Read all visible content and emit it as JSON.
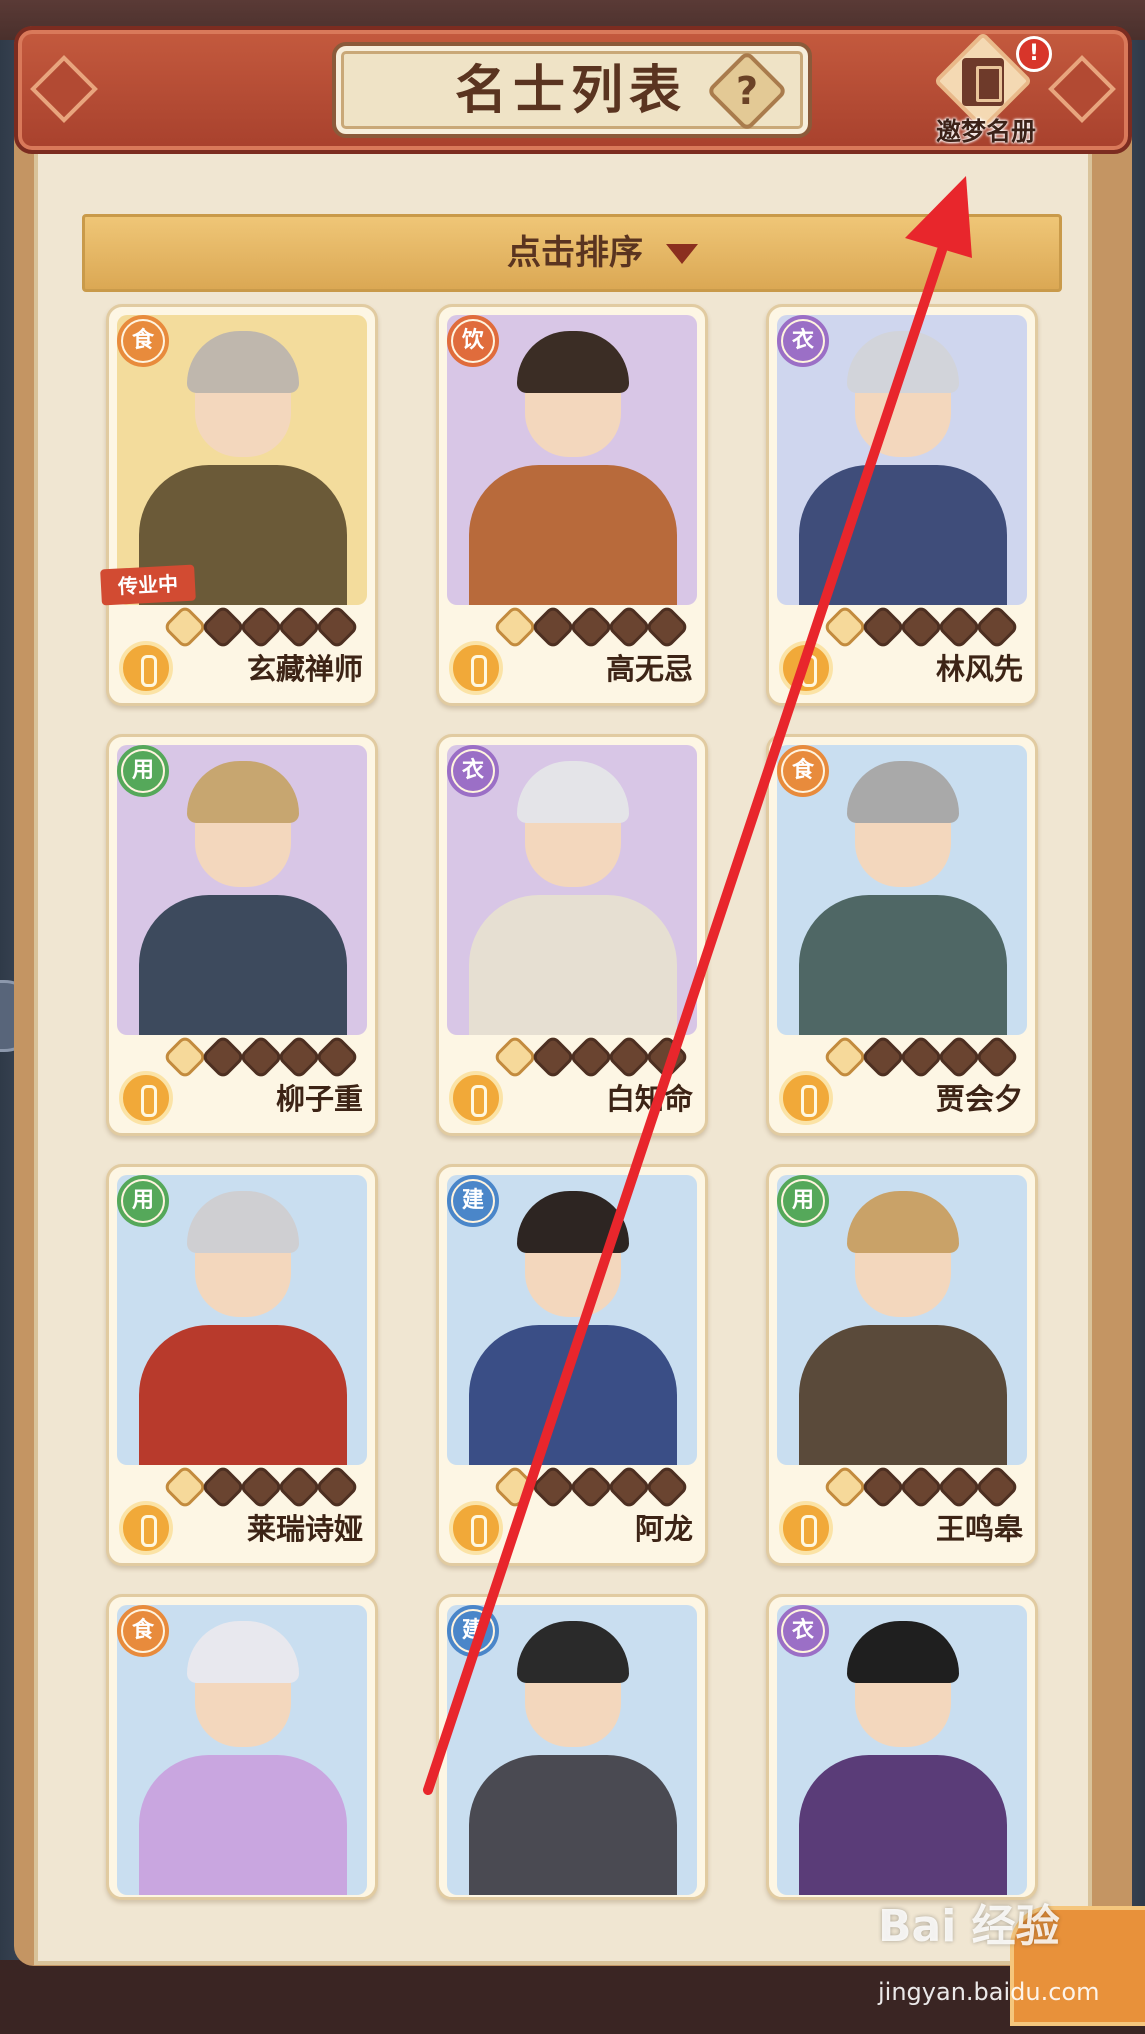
{
  "header": {
    "title": "名士列表",
    "help_symbol": "?",
    "book_label": "邀梦名册",
    "alert_symbol": "!"
  },
  "sort": {
    "label": "点击排序"
  },
  "cards": [
    {
      "name": "玄藏禅师",
      "type": "食",
      "type_color": "#e88b3c",
      "bg": "#f3dc9c",
      "hair": "#bfb7ad",
      "robe": "#6b5a38",
      "stars_filled": 1,
      "stars_total": 5,
      "tag": "传业中"
    },
    {
      "name": "高无忌",
      "type": "饮",
      "type_color": "#e06c3c",
      "bg": "#d8c6e6",
      "hair": "#3b2d25",
      "robe": "#b86a3b",
      "stars_filled": 1,
      "stars_total": 5,
      "tag": ""
    },
    {
      "name": "林风先",
      "type": "衣",
      "type_color": "#9b6fc6",
      "bg": "#cfd6ee",
      "hair": "#d2d4da",
      "robe": "#3f4d7a",
      "stars_filled": 1,
      "stars_total": 5,
      "tag": ""
    },
    {
      "name": "柳子重",
      "type": "用",
      "type_color": "#55a85a",
      "bg": "#d8c6e6",
      "hair": "#c7a670",
      "robe": "#3d4a5d",
      "stars_filled": 1,
      "stars_total": 5,
      "tag": ""
    },
    {
      "name": "白知命",
      "type": "衣",
      "type_color": "#9b6fc6",
      "bg": "#d8c6e6",
      "hair": "#e4e4e8",
      "robe": "#e6dfd2",
      "stars_filled": 1,
      "stars_total": 5,
      "tag": ""
    },
    {
      "name": "贾会夕",
      "type": "食",
      "type_color": "#e88b3c",
      "bg": "#c9def0",
      "hair": "#a9a9a9",
      "robe": "#4f6765",
      "stars_filled": 1,
      "stars_total": 5,
      "tag": ""
    },
    {
      "name": "莱瑞诗娅",
      "type": "用",
      "type_color": "#55a85a",
      "bg": "#c9def0",
      "hair": "#cfcfd2",
      "robe": "#b83a2c",
      "stars_filled": 1,
      "stars_total": 5,
      "tag": ""
    },
    {
      "name": "阿龙",
      "type": "建",
      "type_color": "#4a86c9",
      "bg": "#c9def0",
      "hair": "#2d2522",
      "robe": "#3a4e86",
      "stars_filled": 1,
      "stars_total": 5,
      "tag": ""
    },
    {
      "name": "王鸣皋",
      "type": "用",
      "type_color": "#55a85a",
      "bg": "#c9def0",
      "hair": "#c9a268",
      "robe": "#5a4a3a",
      "stars_filled": 1,
      "stars_total": 5,
      "tag": ""
    },
    {
      "name": "",
      "type": "食",
      "type_color": "#e88b3c",
      "bg": "#c9def0",
      "hair": "#e8e8ee",
      "robe": "#c9a6e0",
      "stars_filled": 1,
      "stars_total": 5,
      "tag": ""
    },
    {
      "name": "",
      "type": "建",
      "type_color": "#4a86c9",
      "bg": "#c9def0",
      "hair": "#2a2a2a",
      "robe": "#4a4a52",
      "stars_filled": 1,
      "stars_total": 5,
      "tag": ""
    },
    {
      "name": "",
      "type": "衣",
      "type_color": "#9b6fc6",
      "bg": "#c9def0",
      "hair": "#1f1f1f",
      "robe": "#5a3c78",
      "stars_filled": 1,
      "stars_total": 5,
      "tag": ""
    }
  ],
  "watermark": {
    "brand": "Bai 经验",
    "url": "jingyan.baidu.com"
  },
  "colors": {
    "header_red": "#b24a33",
    "panel_cream": "#f0e6d2",
    "sort_gold": "#e4b560",
    "annotation_red": "#e8262c"
  },
  "icons": [
    "help-icon",
    "book-icon",
    "alert-icon",
    "sort-caret-icon",
    "coin-icon",
    "star-icon"
  ]
}
